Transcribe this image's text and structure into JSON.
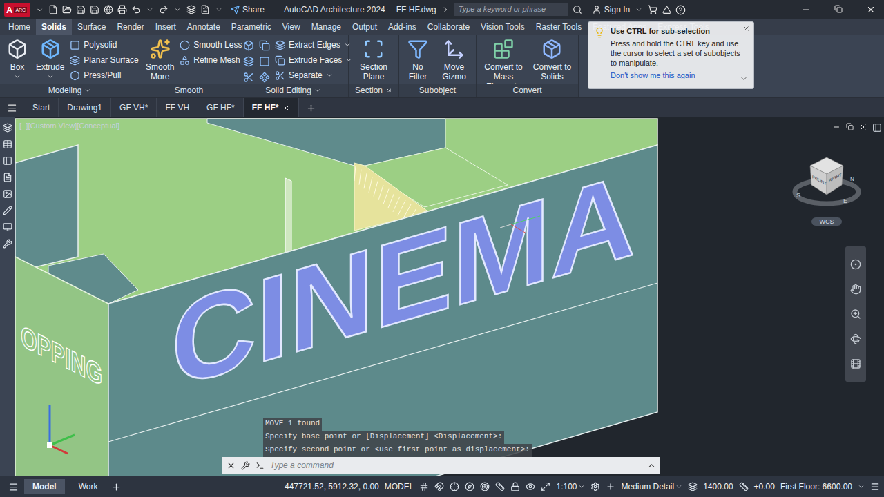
{
  "app": {
    "logo_letter": "A",
    "logo_badge": "ARC",
    "share": "Share",
    "title": "AutoCAD Architecture 2024",
    "file": "FF HF.dwg",
    "search_placeholder": "Type a keyword or phrase",
    "sign_in": "Sign In"
  },
  "ribbon_tabs": [
    {
      "label": "Home",
      "selected": false
    },
    {
      "label": "Solids",
      "selected": true
    },
    {
      "label": "Surface",
      "selected": false
    },
    {
      "label": "Render",
      "selected": false
    },
    {
      "label": "Insert",
      "selected": false
    },
    {
      "label": "Annotate",
      "selected": false
    },
    {
      "label": "Parametric",
      "selected": false
    },
    {
      "label": "View",
      "selected": false
    },
    {
      "label": "Manage",
      "selected": false
    },
    {
      "label": "Output",
      "selected": false
    },
    {
      "label": "Add-ins",
      "selected": false
    },
    {
      "label": "Collaborate",
      "selected": false
    },
    {
      "label": "Vision Tools",
      "selected": false
    },
    {
      "label": "Raster Tools",
      "selected": false
    },
    {
      "label": "Featured Apps",
      "selected": false
    },
    {
      "label": "Express Tools",
      "selected": false
    }
  ],
  "ribbon_panels": [
    {
      "title": "Modeling",
      "menu": true,
      "launcher": false,
      "large": [
        {
          "label": "Box",
          "dropdown": true
        },
        {
          "label": "Extrude",
          "dropdown": true
        }
      ],
      "small": [
        {
          "label": "Polysolid",
          "dropdown": false
        },
        {
          "label": "Planar Surface",
          "dropdown": false
        },
        {
          "label": "Press/Pull",
          "dropdown": false
        }
      ]
    },
    {
      "title": "Smooth",
      "menu": false,
      "launcher": false,
      "large": [
        {
          "label": "Smooth More",
          "dropdown": false
        }
      ],
      "small": [
        {
          "label": "Smooth Less",
          "dropdown": false
        },
        {
          "label": "Refine Mesh",
          "dropdown": false
        }
      ]
    },
    {
      "title": "Solid Editing",
      "menu": true,
      "launcher": false,
      "large": [],
      "small": [
        {
          "label": "Extract Edges",
          "dropdown": true
        },
        {
          "label": "Extrude Faces",
          "dropdown": true
        },
        {
          "label": "Separate",
          "dropdown": true
        }
      ]
    },
    {
      "title": "Section",
      "menu": false,
      "launcher": true,
      "large": [
        {
          "label": "Section Plane",
          "dropdown": false
        }
      ],
      "small": []
    },
    {
      "title": "Subobject",
      "menu": false,
      "launcher": false,
      "large": [
        {
          "label": "No Filter",
          "dropdown": true
        },
        {
          "label": "Move Gizmo",
          "dropdown": true
        }
      ],
      "small": []
    },
    {
      "title": "Convert",
      "menu": false,
      "launcher": false,
      "large": [
        {
          "label": "Convert to Mass Elements",
          "dropdown": false
        },
        {
          "label": "Convert to Solids",
          "dropdown": false
        }
      ],
      "small": []
    }
  ],
  "file_tabs": [
    {
      "label": "Start",
      "selected": false
    },
    {
      "label": "Drawing1",
      "selected": false
    },
    {
      "label": "GF VH*",
      "selected": false
    },
    {
      "label": "FF VH",
      "selected": false
    },
    {
      "label": "GF HF*",
      "selected": false
    },
    {
      "label": "FF HF*",
      "selected": true
    }
  ],
  "viewport": {
    "label": "[−][Custom View][Conceptual]",
    "facade_sign": "CINEMA",
    "side_sign": "OPPING",
    "viewcube": {
      "faces": [
        "FRONT",
        "RIGHT"
      ],
      "compass": [
        "S",
        "E",
        "N"
      ]
    },
    "ucs": "WCS"
  },
  "tooltip": {
    "title": "Use CTRL for sub-selection",
    "body": "Press and hold the CTRL key and use the cursor to select a set of subobjects to manipulate.",
    "link": "Don't show me this again"
  },
  "command_line": {
    "history": [
      "MOVE 1 found",
      "Specify base point or [Displacement] <Displacement>:",
      "Specify second point or <use first point as displacement>:"
    ],
    "placeholder": "Type a command"
  },
  "status_bar": {
    "layout_tabs": [
      {
        "label": "Model",
        "selected": true
      },
      {
        "label": "Work",
        "selected": false
      }
    ],
    "coordinates": "447721.52, 5912.32, 0.00",
    "space": "MODEL",
    "scale": "1:100",
    "detail": "Medium Detail",
    "elevation": "1400.00",
    "offset": "+0.00",
    "floor": "First Floor: 6600.00"
  }
}
